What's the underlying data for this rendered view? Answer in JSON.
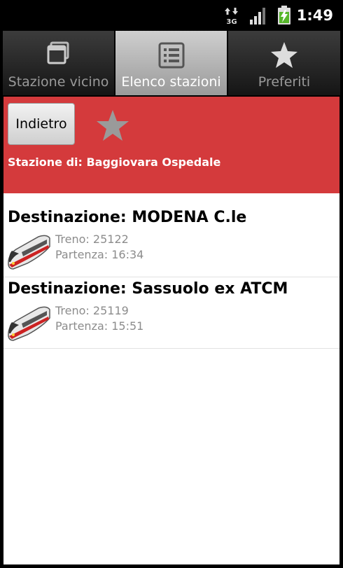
{
  "status_bar": {
    "network": "3G",
    "time": "1:49",
    "icons": [
      "network-3g-icon",
      "signal-icon",
      "battery-charging-icon"
    ]
  },
  "tabs": [
    {
      "label": "Stazione vicino",
      "icon": "stacked-windows-icon",
      "selected": false
    },
    {
      "label": "Elenco stazioni",
      "icon": "list-icon",
      "selected": true
    },
    {
      "label": "Preferiti",
      "icon": "star-icon",
      "selected": false
    }
  ],
  "header": {
    "back_label": "Indietro",
    "favorite_icon": "star-icon",
    "station_text": "Stazione di: Baggiovara Ospedale",
    "background_color": "#d43a3c"
  },
  "departures": [
    {
      "destination": "Destinazione: MODENA C.le",
      "train": "Treno: 25122",
      "departure": "Partenza: 16:34",
      "icon": "train-icon"
    },
    {
      "destination": "Destinazione: Sassuolo ex ATCM",
      "train": "Treno: 25119",
      "departure": "Partenza: 15:51",
      "icon": "train-icon"
    }
  ]
}
